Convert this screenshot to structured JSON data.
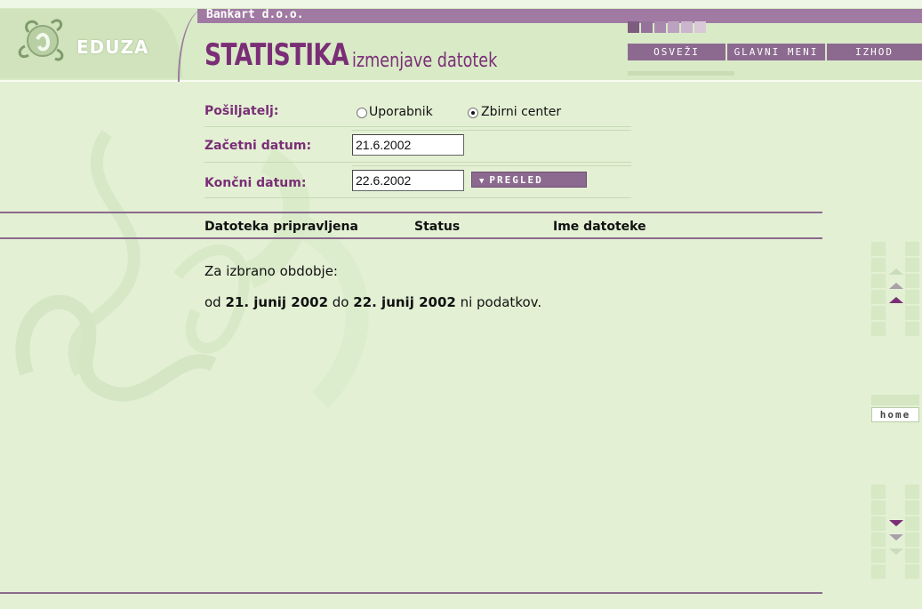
{
  "header": {
    "logo_text": "EDUZA",
    "bank_name": "Bankart d.o.o.",
    "title_main": "STATISTIKA",
    "title_sub": "izmenjave datotek",
    "nav": {
      "refresh": "OSVEŽI",
      "main_menu": "GLAVNI MENI",
      "exit": "IZHOD"
    }
  },
  "form": {
    "sender_label": "Pošiljatelj:",
    "sender_options": [
      {
        "label": "Uporabnik",
        "selected": false
      },
      {
        "label": "Zbirni center",
        "selected": true
      }
    ],
    "start_label": "Začetni datum:",
    "start_value": "21.6.2002",
    "end_label": "Končni datum:",
    "end_value": "22.6.2002",
    "view_button": "PREGLED"
  },
  "table": {
    "columns": [
      "Datoteka pripravljena",
      "Status",
      "Ime datoteke"
    ]
  },
  "message": {
    "line1": "Za izbrano obdobje:",
    "prefix": "od ",
    "from": "21. junij 2002",
    "mid": " do ",
    "to": "22. junij 2002",
    "suffix": " ni podatkov."
  },
  "side": {
    "home": "home"
  },
  "colors": {
    "accent": "#7a2e76",
    "button": "#8c6a8f",
    "background": "#e3f0d4"
  }
}
